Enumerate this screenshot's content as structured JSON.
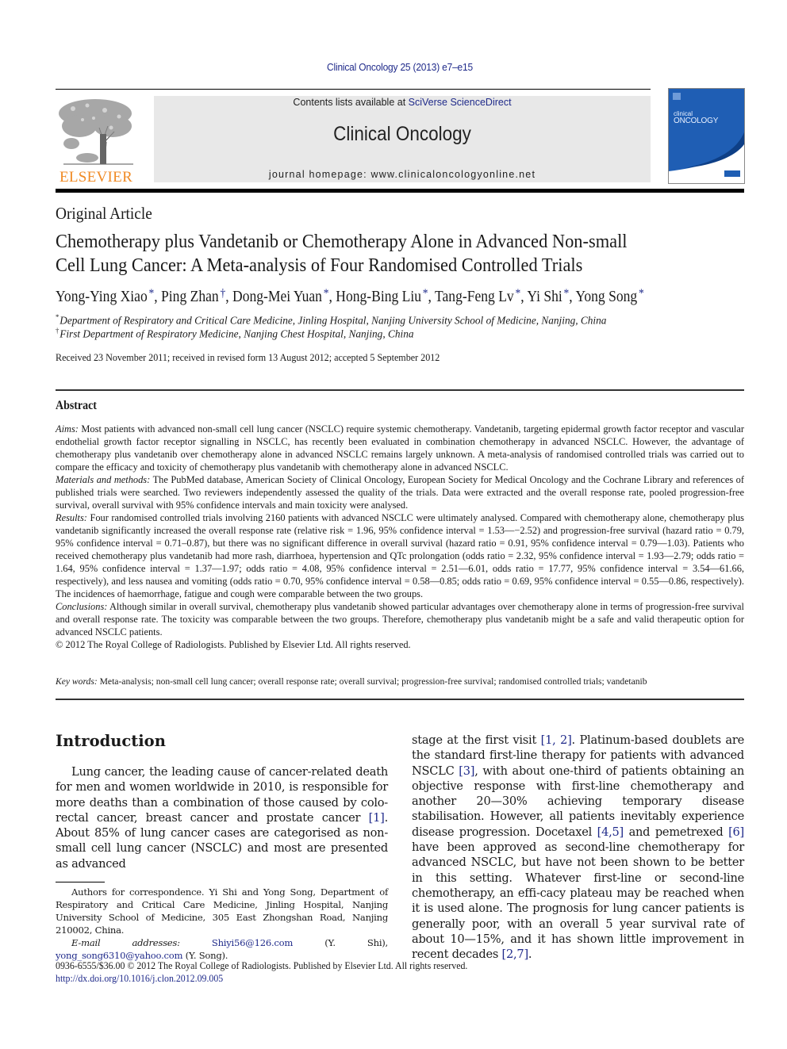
{
  "header": {
    "journal_citation": "Clinical Oncology 25 (2013) e7–e15",
    "contents_prefix": "Contents lists available at ",
    "contents_link": "SciVerse ScienceDirect",
    "journal_name": "Clinical Oncology",
    "homepage": "journal homepage: www.clinicaloncologyonline.net",
    "publisher_logo_text": "ELSEVIER",
    "cover_title_line1": "clinical",
    "cover_title_line2": "ONCOLOGY",
    "colors": {
      "link": "#1f2a8a",
      "elsevier_orange": "#f08a24",
      "cover_blue": "#1f5eb4",
      "header_gray": "#e8e8e8"
    }
  },
  "article": {
    "type": "Original Article",
    "title_line1": "Chemotherapy plus Vandetanib or Chemotherapy Alone in Advanced Non-small",
    "title_line2": "Cell Lung Cancer: A Meta-analysis of Four Randomised Controlled Trials",
    "authors": [
      {
        "name": "Yong-Ying Xiao",
        "mark": "*"
      },
      {
        "name": "Ping Zhan",
        "mark": "†"
      },
      {
        "name": "Dong-Mei Yuan",
        "mark": "*"
      },
      {
        "name": "Hong-Bing Liu",
        "mark": "*"
      },
      {
        "name": "Tang-Feng Lv",
        "mark": "*"
      },
      {
        "name": "Yi Shi",
        "mark": "*"
      },
      {
        "name": "Yong Song",
        "mark": "*"
      }
    ],
    "affiliations": [
      {
        "mark": "*",
        "text": "Department of Respiratory and Critical Care Medicine, Jinling Hospital, Nanjing University School of Medicine, Nanjing, China"
      },
      {
        "mark": "†",
        "text": "First Department of Respiratory Medicine, Nanjing Chest Hospital, Nanjing, China"
      }
    ],
    "received": "Received 23 November 2011; received in revised form 13 August 2012; accepted 5 September 2012"
  },
  "abstract": {
    "heading": "Abstract",
    "sections": [
      {
        "label": "Aims:",
        "text": " Most patients with advanced non-small cell lung cancer (NSCLC) require systemic chemotherapy. Vandetanib, targeting epidermal growth factor receptor and vascular endothelial growth factor receptor signalling in NSCLC, has recently been evaluated in combination chemotherapy in advanced NSCLC. However, the advantage of chemotherapy plus vandetanib over chemotherapy alone in advanced NSCLC remains largely unknown. A meta-analysis of randomised controlled trials was carried out to compare the efficacy and toxicity of chemotherapy plus vandetanib with chemotherapy alone in advanced NSCLC."
      },
      {
        "label": "Materials and methods:",
        "text": " The PubMed database, American Society of Clinical Oncology, European Society for Medical Oncology and the Cochrane Library and references of published trials were searched. Two reviewers independently assessed the quality of the trials. Data were extracted and the overall response rate, pooled progression-free survival, overall survival with 95% confidence intervals and main toxicity were analysed."
      },
      {
        "label": "Results:",
        "text": " Four randomised controlled trials involving 2160 patients with advanced NSCLC were ultimately analysed. Compared with chemotherapy alone, chemotherapy plus vandetanib significantly increased the overall response rate (relative risk = 1.96, 95% confidence interval = 1.53—−2.52) and progression-free survival (hazard ratio = 0.79, 95% confidence interval = 0.71–0.87), but there was no significant difference in overall survival (hazard ratio = 0.91, 95% confidence interval = 0.79—1.03). Patients who received chemotherapy plus vandetanib had more rash, diarrhoea, hypertension and QTc prolongation (odds ratio = 2.32, 95% confidence interval = 1.93—2.79; odds ratio = 1.64, 95% confidence interval = 1.37—1.97; odds ratio = 4.08, 95% confidence interval = 2.51—6.01, odds ratio = 17.77, 95% confidence interval = 3.54—61.66, respectively), and less nausea and vomiting (odds ratio = 0.70, 95% confidence interval = 0.58—0.85; odds ratio = 0.69, 95% confidence interval = 0.55—0.86, respectively). The incidences of haemorrhage, fatigue and cough were comparable between the two groups."
      },
      {
        "label": "Conclusions:",
        "text": " Although similar in overall survival, chemotherapy plus vandetanib showed particular advantages over chemotherapy alone in terms of progression-free survival and overall response rate. The toxicity was comparable between the two groups. Therefore, chemotherapy plus vandetanib might be a safe and valid therapeutic option for advanced NSCLC patients."
      }
    ],
    "copyright": "© 2012 The Royal College of Radiologists. Published by Elsevier Ltd. All rights reserved.",
    "keywords_label": "Key words:",
    "keywords": " Meta-analysis; non-small cell lung cancer; overall response rate; overall survival; progression-free survival; randomised controlled trials; vandetanib"
  },
  "introduction": {
    "heading": "Introduction",
    "left": [
      {
        "t": "Lung cancer, the leading cause of cancer-related death for men and women worldwide in 2010, is responsible for more deaths than a combination of those caused by colo-rectal cancer, breast cancer and prostate cancer "
      },
      {
        "ref": "[1]"
      },
      {
        "t": ". About 85% of lung cancer cases are categorised as non-small cell lung cancer (NSCLC) and most are presented as advanced"
      }
    ],
    "right": [
      {
        "t": "stage at the first visit "
      },
      {
        "ref": "[1, 2]"
      },
      {
        "t": ". Platinum-based doublets are the standard first-line therapy for patients with advanced NSCLC "
      },
      {
        "ref": "[3]"
      },
      {
        "t": ", with about one-third of patients obtaining an objective response with first-line chemotherapy and another 20—30% achieving temporary disease stabilisation. However, all patients inevitably experience disease progression. Docetaxel "
      },
      {
        "ref": "[4,5]"
      },
      {
        "t": " and pemetrexed "
      },
      {
        "ref": "[6]"
      },
      {
        "t": " have been approved as second-line chemotherapy for advanced NSCLC, but have not been shown to be better in this setting. Whatever first-line or second-line chemotherapy, an effi-cacy plateau may be reached when it is used alone. The prognosis for lung cancer patients is generally poor, with an overall 5 year survival rate of about 10—15%, and it has shown little improvement in recent decades "
      },
      {
        "ref": "[2,7]"
      },
      {
        "t": "."
      }
    ]
  },
  "footnote": {
    "correspondence": "Authors for correspondence. Yi Shi and Yong Song, Department of Respiratory and Critical Care Medicine, Jinling Hospital, Nanjing University School of Medicine, 305 East Zhongshan Road, Nanjing 210002, China.",
    "email_label": "E-mail addresses:",
    "email1": "Shiyi56@126.com",
    "email1_owner": " (Y. Shi), ",
    "email2": "yong_song6310@yahoo.com",
    "email2_owner": " (Y. Song)."
  },
  "bottom": {
    "issn_line": "0936-6555/$36.00 © 2012 The Royal College of Radiologists. Published by Elsevier Ltd. All rights reserved.",
    "doi": "http://dx.doi.org/10.1016/j.clon.2012.09.005"
  }
}
